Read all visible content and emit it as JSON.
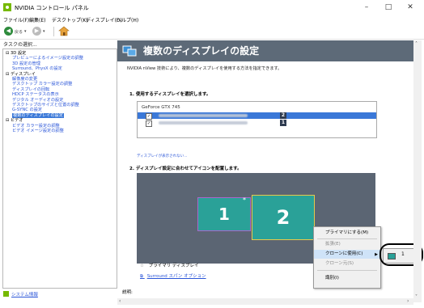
{
  "window": {
    "title": "NVIDIA コントロール パネル",
    "minimize": "–",
    "maximize": "□",
    "close": "✕"
  },
  "menu": [
    "ファイル(F)",
    "編集(E)",
    "デスクトップ(K)",
    "ディスプレイ(D)",
    "ヘルプ(H)"
  ],
  "toolbar": {
    "back_label": "戻る",
    "back_icon": "back-arrow-icon",
    "forward_icon": "forward-arrow-icon",
    "home_icon": "home-icon"
  },
  "task_pane": {
    "label": "タスクの選択...",
    "items": [
      {
        "text": "3D 設定",
        "level": 0,
        "type": "category"
      },
      {
        "text": "プレビューによるイメージ設定の調整",
        "level": 1,
        "type": "link"
      },
      {
        "text": "3D 設定の管理",
        "level": 1,
        "type": "link"
      },
      {
        "text": "Surround、PhysX の設定",
        "level": 1,
        "type": "link"
      },
      {
        "text": "ディスプレイ",
        "level": 0,
        "type": "category"
      },
      {
        "text": "解像度の変更",
        "level": 1,
        "type": "link"
      },
      {
        "text": "デスクトップ カラー設定の調整",
        "level": 1,
        "type": "link"
      },
      {
        "text": "ディスプレイの回転",
        "level": 1,
        "type": "link"
      },
      {
        "text": "HDCP ステータスの表示",
        "level": 1,
        "type": "link"
      },
      {
        "text": "デジタル オーディオの設定",
        "level": 1,
        "type": "link"
      },
      {
        "text": "デスクトップのサイズと位置の調整",
        "level": 1,
        "type": "link"
      },
      {
        "text": "G-SYNC の設定",
        "level": 1,
        "type": "link"
      },
      {
        "text": "複数のディスプレイの設定",
        "level": 1,
        "type": "selected"
      },
      {
        "text": "ビデオ",
        "level": 0,
        "type": "category"
      },
      {
        "text": "ビデオ カラー設定の調整",
        "level": 1,
        "type": "link"
      },
      {
        "text": "ビデオ イメージ設定の調整",
        "level": 1,
        "type": "link"
      }
    ],
    "system_info": "システム情報"
  },
  "content": {
    "title": "複数のディスプレイの設定",
    "description": "NVIDIA nView 技術により、複数のディスプレイを使用する方法を指定できます。",
    "section1": "1. 使用するディスプレイを選択します。",
    "gpu": "GeForce GTX 745",
    "displays": [
      {
        "checked": true,
        "number": "2",
        "selected": true
      },
      {
        "checked": true,
        "number": "1",
        "selected": false
      }
    ],
    "checkmark": "✓",
    "missing_hint": "ディスプレイが表示されない...",
    "section2": "2. ディスプレイ設定に合わせてアイコンを配置します。",
    "monitors": [
      {
        "number": "1",
        "primary_mark": "*"
      },
      {
        "number": "2"
      }
    ],
    "primary_label": "プライマリ ディスプレイ",
    "surround_link": "Surround スパン オプション",
    "explanation_label": "説明:"
  },
  "context_menu": {
    "items": [
      {
        "label": "プライマリにする(M)",
        "enabled": true
      },
      {
        "label": "拡張(E)",
        "enabled": false
      },
      {
        "label": "クローンに使用(C)",
        "enabled": true,
        "highlighted": true
      },
      {
        "label": "クローン元(S)",
        "enabled": false
      },
      {
        "label": "識別(I)",
        "enabled": true
      }
    ],
    "submenu": {
      "label": "1"
    }
  },
  "colors": {
    "nvidia_green": "#76b900",
    "header_bg": "#5d6a78",
    "monitor": "#2aa198",
    "selection": "#3a78d8"
  }
}
